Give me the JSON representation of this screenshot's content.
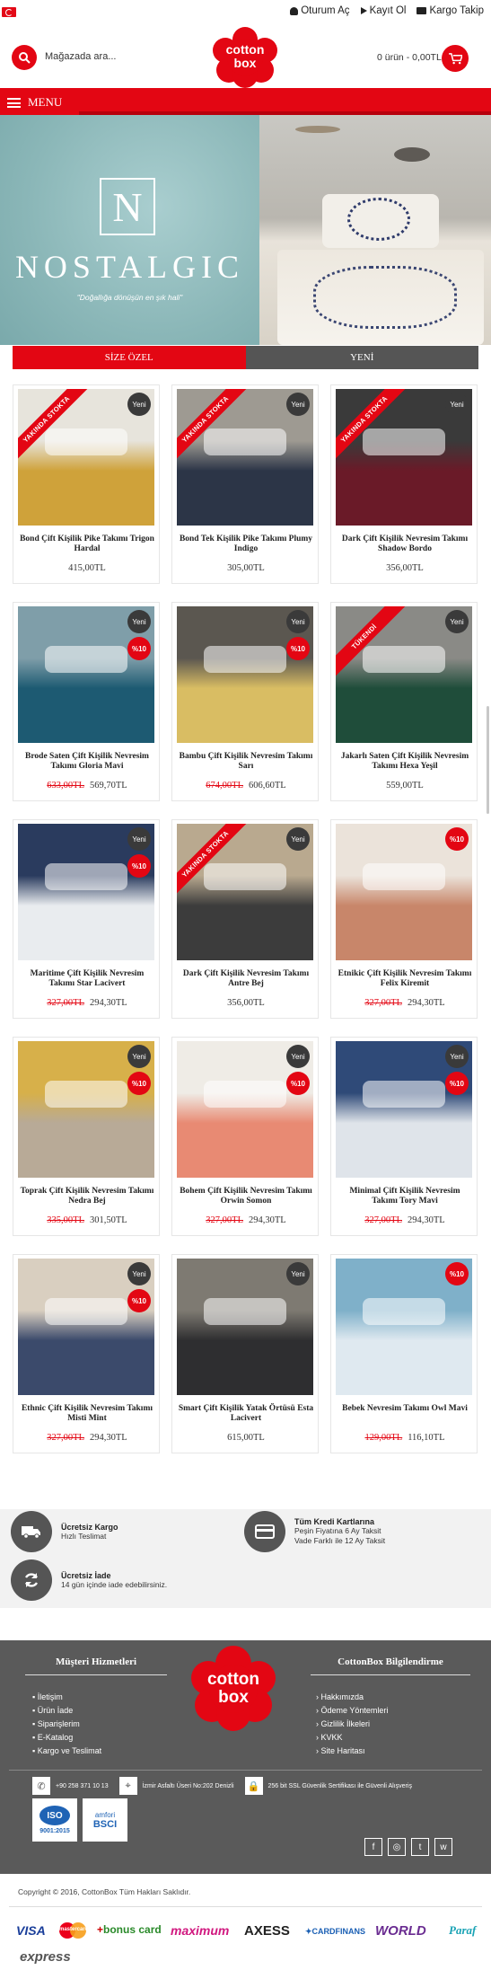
{
  "header": {
    "links": [
      "Oturum Aç",
      "Kayıt Ol",
      "Kargo Takip"
    ],
    "search_placeholder": "Mağazada ara...",
    "logo_line1": "cotton",
    "logo_line2": "box",
    "cart_summary": "0 ürün - 0,00TL",
    "menu_label": "MENU"
  },
  "hero": {
    "brand": "NOSTALGIC",
    "emblem_letter": "N",
    "slogan": "\"Doğallığa dönüşün en şık hali\""
  },
  "tabs": [
    "SİZE ÖZEL",
    "YENİ"
  ],
  "products": [
    {
      "name": "Bond Çift Kişilik Pike Takımı Trigon Hardal",
      "price": "415,00TL",
      "old": "",
      "badge_new": "Yeni",
      "ribbon": "YAKINDA STOKTA",
      "discount": "",
      "c1": "#cfa23a",
      "c2": "#e7e4dc"
    },
    {
      "name": "Bond Tek Kişilik Pike Takımı Plumy Indigo",
      "price": "305,00TL",
      "old": "",
      "badge_new": "Yeni",
      "ribbon": "YAKINDA STOKTA",
      "discount": "",
      "c1": "#2c3547",
      "c2": "#9e9a92"
    },
    {
      "name": "Dark Çift Kişilik Nevresim Takımı Shadow Bordo",
      "price": "356,00TL",
      "old": "",
      "badge_new": "Yeni",
      "ribbon": "YAKINDA STOKTA",
      "discount": "",
      "c1": "#6a1a28",
      "c2": "#3a3a3a"
    },
    {
      "name": "Brode Saten Çift Kişilik Nevresim Takımı Gloria Mavi",
      "price": "569,70TL",
      "old": "633,00TL",
      "badge_new": "Yeni",
      "ribbon": "",
      "discount": "%10",
      "c1": "#1d5a72",
      "c2": "#7f9ea9"
    },
    {
      "name": "Bambu Çift Kişilik Nevresim Takımı Sarı",
      "price": "606,60TL",
      "old": "674,00TL",
      "badge_new": "Yeni",
      "ribbon": "",
      "discount": "%10",
      "c1": "#d9bd63",
      "c2": "#5b5750"
    },
    {
      "name": "Jakarlı Saten Çift Kişilik Nevresim Takımı Hexa Yeşil",
      "price": "559,00TL",
      "old": "",
      "badge_new": "Yeni",
      "ribbon": "TÜKENDİ",
      "discount": "",
      "c1": "#1f4d3a",
      "c2": "#8a8a86"
    },
    {
      "name": "Maritime Çift Kişilik Nevresim Takımı Star Lacivert",
      "price": "294,30TL",
      "old": "327,00TL",
      "badge_new": "Yeni",
      "ribbon": "",
      "discount": "%10",
      "c1": "#e9ecef",
      "c2": "#2a3b5e"
    },
    {
      "name": "Dark Çift Kişilik Nevresim Takımı Antre Bej",
      "price": "356,00TL",
      "old": "",
      "badge_new": "Yeni",
      "ribbon": "YAKINDA STOKTA",
      "discount": "",
      "c1": "#3c3c3c",
      "c2": "#b9a98f"
    },
    {
      "name": "Etnikic Çift Kişilik Nevresim Takımı Felix Kiremit",
      "price": "294,30TL",
      "old": "327,00TL",
      "badge_new": "",
      "ribbon": "",
      "discount": "%10",
      "c1": "#c8866a",
      "c2": "#ebe3da"
    },
    {
      "name": "Toprak Çift Kişilik Nevresim Takımı Nedra Bej",
      "price": "301,50TL",
      "old": "335,00TL",
      "badge_new": "Yeni",
      "ribbon": "",
      "discount": "%10",
      "c1": "#b8aa97",
      "c2": "#d7b04a"
    },
    {
      "name": "Bohem Çift Kişilik Nevresim Takımı Orwin Somon",
      "price": "294,30TL",
      "old": "327,00TL",
      "badge_new": "Yeni",
      "ribbon": "",
      "discount": "%10",
      "c1": "#e88a73",
      "c2": "#efece6"
    },
    {
      "name": "Minimal Çift Kişilik Nevresim Takımı Tory Mavi",
      "price": "294,30TL",
      "old": "327,00TL",
      "badge_new": "Yeni",
      "ribbon": "",
      "discount": "%10",
      "c1": "#dfe4ea",
      "c2": "#2f4a78"
    },
    {
      "name": "Ethnic Çift Kişilik Nevresim Takımı Misti Mint",
      "price": "294,30TL",
      "old": "327,00TL",
      "badge_new": "Yeni",
      "ribbon": "",
      "discount": "%10",
      "c1": "#3b4a6b",
      "c2": "#d9cfc0"
    },
    {
      "name": "Smart Çift Kişilik Yatak Örtüsü Esta Lacivert",
      "price": "615,00TL",
      "old": "",
      "badge_new": "Yeni",
      "ribbon": "",
      "discount": "",
      "c1": "#2e2e30",
      "c2": "#7e7a72"
    },
    {
      "name": "Bebek Nevresim Takımı Owl Mavi",
      "price": "116,10TL",
      "old": "129,00TL",
      "badge_new": "",
      "ribbon": "",
      "discount": "%10",
      "c1": "#dfe9f0",
      "c2": "#7fb0c9"
    }
  ],
  "features": [
    {
      "title": "Ücretsiz Kargo",
      "sub": "Hızlı Teslimat",
      "icon": "truck-icon"
    },
    {
      "title": "Tüm Kredi Kartlarına",
      "sub": "Peşin Fiyatına 6 Ay Taksit\nVade Farklı ile 12 Ay Taksit",
      "icon": "credit-card-icon"
    },
    {
      "title": "Ücretsiz İade",
      "sub": "14 gün içinde iade edebilirsiniz.",
      "icon": "refresh-icon"
    }
  ],
  "footer": {
    "col1_title": "Müşteri Hizmetleri",
    "col1_links": [
      "İletişim",
      "Ürün İade",
      "Siparişlerim",
      "E-Katalog",
      "Kargo ve Teslimat"
    ],
    "col2_title": "CottonBox Bilgilendirme",
    "col2_links": [
      "Hakkımızda",
      "Ödeme Yöntemleri",
      "Gizlilik İlkeleri",
      "KVKK",
      "Site Haritası"
    ],
    "phone": "+90 258 371 10 13",
    "address": "İzmir Asfaltı Üseri No:202 Denizli",
    "ssl": "256 bit SSL Güvenlik Sertifikası ile Güvenli Alışveriş",
    "iso": "ISO",
    "iso_sub": "9001:2015",
    "bsci_top": "amfori",
    "bsci": "BSCI",
    "social": [
      "f",
      "◎",
      "t",
      "w"
    ],
    "copyright": "Copyright © 2016, CottonBox Tüm Hakları Saklıdır."
  },
  "payments": [
    "VISA",
    "mastercard",
    "bonus card",
    "maximum",
    "AXESS",
    "CARDFINANS",
    "WORLD",
    "Paraf",
    "express"
  ],
  "colors": {
    "brand_red": "#e30613",
    "dark_gray": "#555555"
  }
}
